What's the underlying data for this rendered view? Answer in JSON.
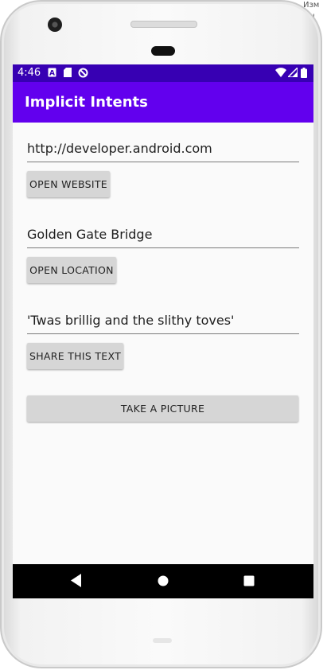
{
  "corner_text": "Изм\nцы",
  "status_bar": {
    "time": "4:46",
    "left_icons": [
      "a-icon",
      "sd-card-icon",
      "blocked-icon"
    ],
    "right_icons": [
      "wifi-icon",
      "signal-icon",
      "battery-icon"
    ],
    "background": "#3700b3"
  },
  "app_bar": {
    "title": "Implicit Intents",
    "background": "#6200ee"
  },
  "form": {
    "website_field": {
      "value": "http://developer.android.com"
    },
    "open_website_label": "OPEN WEBSITE",
    "location_field": {
      "value": "Golden Gate Bridge"
    },
    "open_location_label": "OPEN LOCATION",
    "share_field": {
      "value": "'Twas brillig and the slithy toves'"
    },
    "share_text_label": "SHARE THIS TEXT",
    "take_picture_label": "TAKE A PICTURE"
  },
  "nav_bar": {
    "buttons": [
      "back-icon",
      "home-icon",
      "recents-icon"
    ]
  },
  "colors": {
    "button_bg": "#d6d6d6",
    "screen_bg": "#fafafa"
  }
}
